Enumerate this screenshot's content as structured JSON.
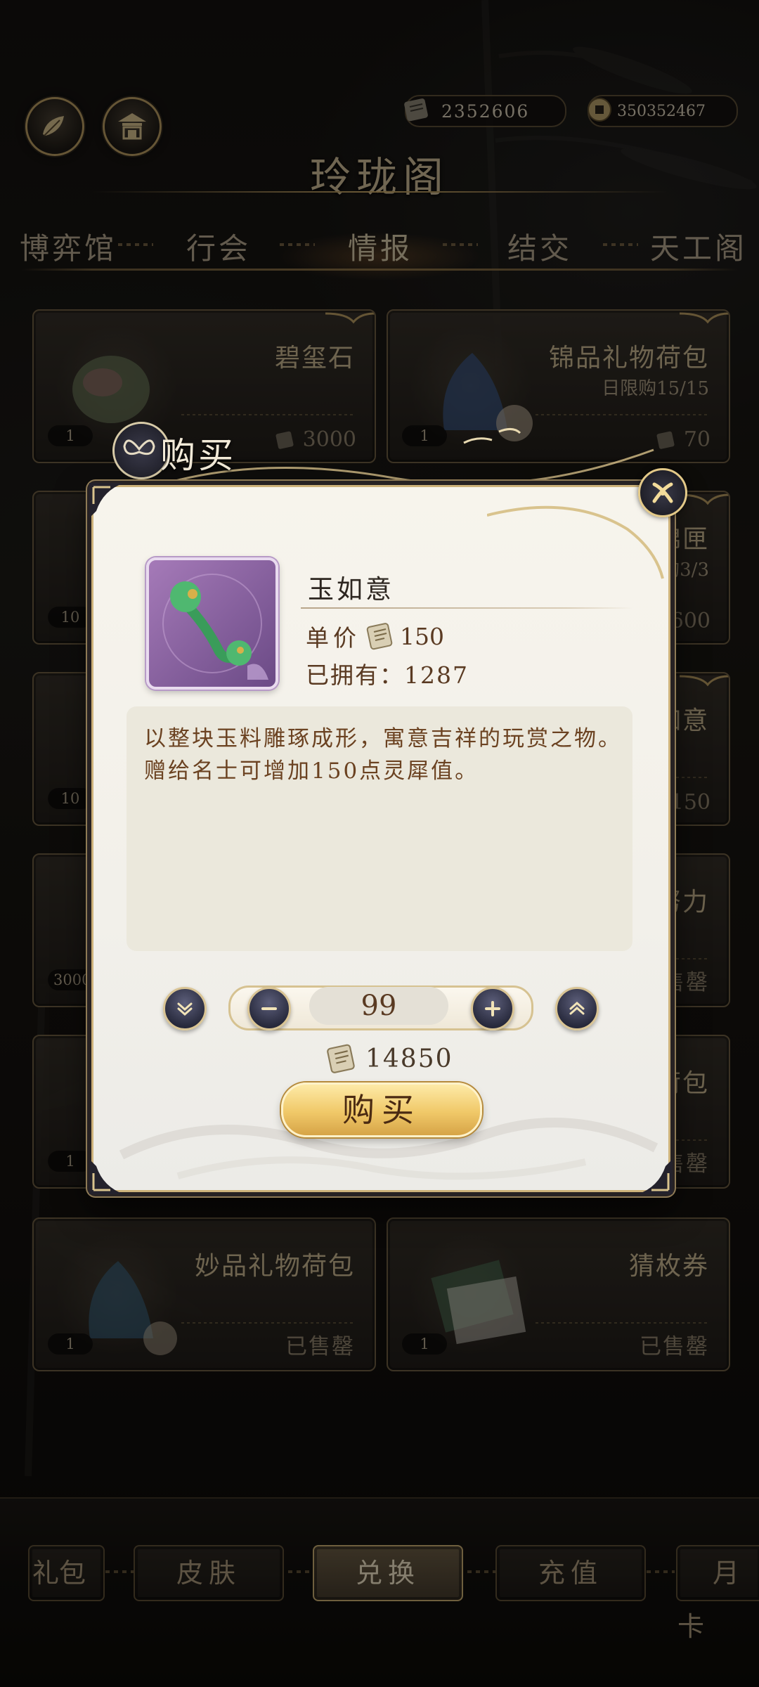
{
  "header": {
    "title": "玲珑阁",
    "currency_silver": "2352606",
    "currency_coin": "350352467"
  },
  "tabs": [
    {
      "label": "博弈馆"
    },
    {
      "label": "行会"
    },
    {
      "label": "情报",
      "active": true
    },
    {
      "label": "结交"
    },
    {
      "label": "天工阁"
    }
  ],
  "cards": {
    "c1": {
      "name": "碧玺石",
      "qty": "1",
      "price": "3000"
    },
    "c2": {
      "name": "锦品礼物荷包",
      "limit": "日限购15/15",
      "qty": "1",
      "price": "70"
    },
    "c3": {
      "name_partial": "锦匣",
      "limit_partial": "购3/3",
      "qty": "10",
      "price": "600"
    },
    "c4": {
      "name_partial": "如意",
      "qty": "10",
      "price": "150"
    },
    "c5": {
      "name_partial": "努力",
      "qty": "30000",
      "sold": "售罄"
    },
    "c6": {
      "name_partial": "荷包",
      "qty": "1",
      "sold": "售罄"
    },
    "c7": {
      "name": "妙品礼物荷包",
      "qty": "1",
      "sold": "已售罄"
    },
    "c8": {
      "name": "猜枚券",
      "qty": "1",
      "sold": "已售罄"
    }
  },
  "dialog": {
    "header": "购买",
    "item_name": "玉如意",
    "unit_price_label": "单价",
    "unit_price": "150",
    "owned_label": "已拥有：1287",
    "description": "以整块玉料雕琢成形，寓意吉祥的玩赏之物。赠给名士可增加150点灵犀值。",
    "quantity": "99",
    "total": "14850",
    "buy_label": "购买",
    "icons": {
      "min": "double-chevron-down-icon",
      "minus": "minus-icon",
      "plus": "plus-icon",
      "max": "double-chevron-up-icon",
      "close": "close-icon",
      "currency": "scroll-currency-icon"
    }
  },
  "bottom_nav": [
    {
      "label": "礼包"
    },
    {
      "label": "皮肤"
    },
    {
      "label": "兑换",
      "active": true
    },
    {
      "label": "充值"
    },
    {
      "label": "月卡"
    }
  ],
  "colors": {
    "accent_gold": "#c9ad72",
    "panel_bg": "#f2f0ea",
    "desc_text": "#6b4221",
    "buy_button": "#f0c868"
  }
}
